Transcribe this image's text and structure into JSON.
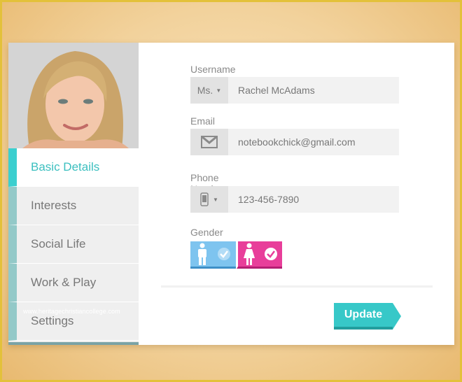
{
  "profile": {
    "photo_icon": "portrait-photo"
  },
  "sidebar": {
    "items": [
      {
        "label": "Basic Details",
        "active": true
      },
      {
        "label": "Interests",
        "active": false
      },
      {
        "label": "Social Life",
        "active": false
      },
      {
        "label": "Work & Play",
        "active": false
      },
      {
        "label": "Settings",
        "active": false
      }
    ]
  },
  "form": {
    "username": {
      "label": "Username",
      "title": "Ms.",
      "value": "Rachel McAdams"
    },
    "email": {
      "label": "Email",
      "icon": "gmail-icon",
      "value": "notebookchick@gmail.com"
    },
    "phone": {
      "label": "Phone Number",
      "icon": "phone-icon",
      "value": "123-456-7890"
    },
    "gender": {
      "label": "Gender",
      "options": [
        "male",
        "female"
      ]
    },
    "update_label": "Update"
  },
  "watermark": "www.heritagechristiancollege.com",
  "colors": {
    "accent": "#37c8c8",
    "male": "#7ec4ef",
    "female": "#e83e9a"
  }
}
